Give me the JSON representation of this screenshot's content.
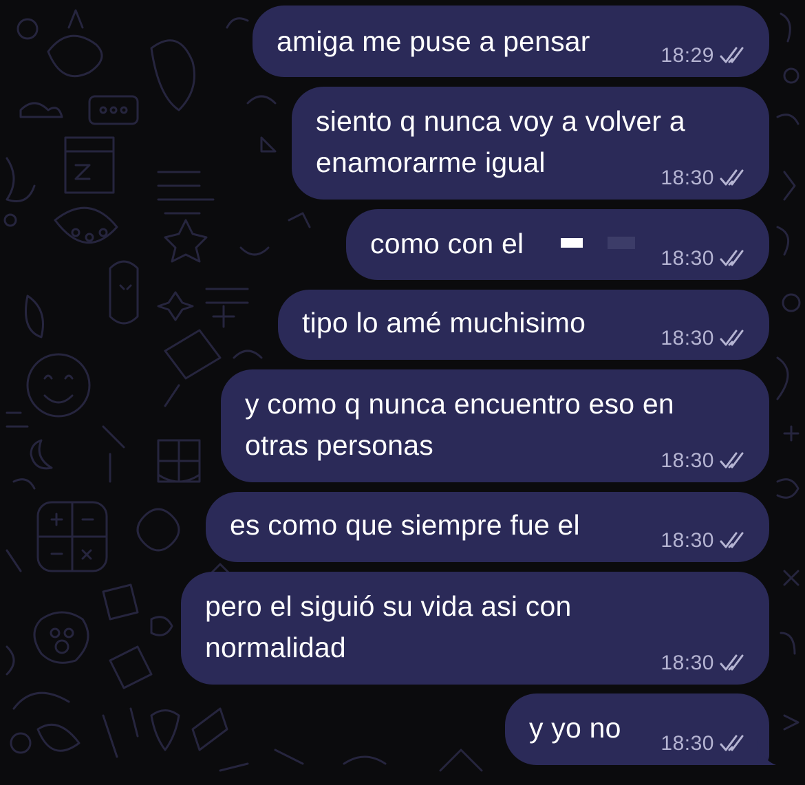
{
  "messages": [
    {
      "text": "amiga me puse a pensar",
      "time": "18:29"
    },
    {
      "text": "siento q nunca voy a volver a",
      "text2": "enamorarme igual",
      "time": "18:30"
    },
    {
      "text": "como con el ",
      "time": "18:30",
      "redacted": true
    },
    {
      "text": "tipo lo amé muchisimo",
      "time": "18:30"
    },
    {
      "text": "y como q nunca encuentro eso en",
      "text2": "otras personas",
      "time": "18:30"
    },
    {
      "text": "es como que siempre fue el",
      "time": "18:30"
    },
    {
      "text": "pero el siguió su vida asi con",
      "text2": "normalidad",
      "time": "18:30"
    },
    {
      "text": "y yo no",
      "time": "18:30"
    }
  ],
  "read_status_icon": "double-check-icon",
  "colors": {
    "background": "#0b0b0d",
    "bubble": "#2b2a58",
    "text": "#ffffff",
    "meta": "#b5b4d2",
    "doodle": "#27263f"
  }
}
